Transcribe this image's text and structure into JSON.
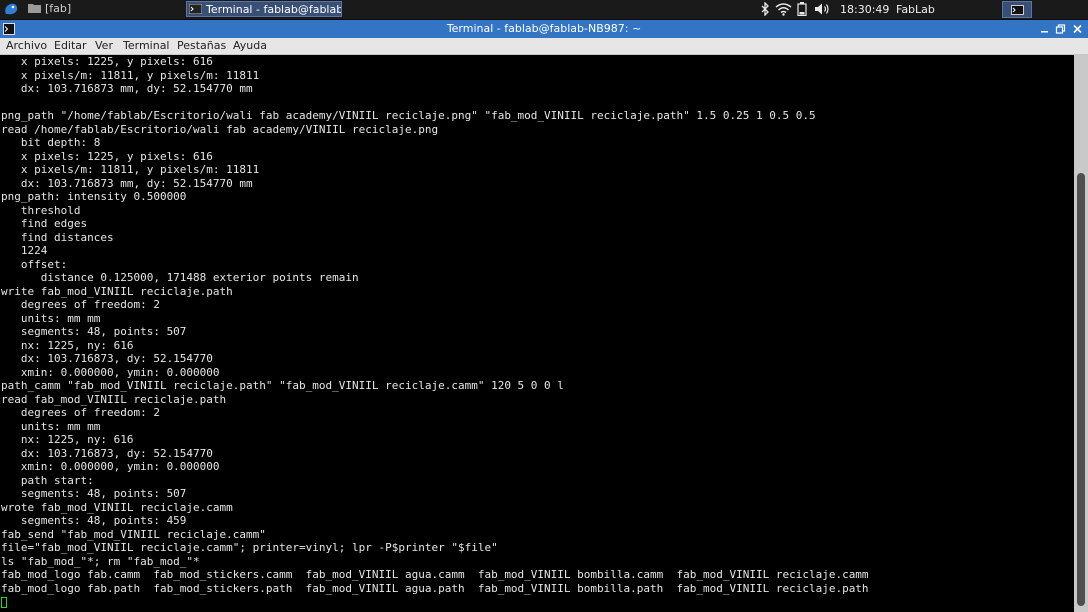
{
  "taskbar": {
    "start_icon": "xfce-mouse-icon",
    "tasks": [
      {
        "label": "[fab]",
        "icon": "folder-icon"
      },
      {
        "label": "Terminal - fablab@fablab-...",
        "icon": "terminal-icon"
      }
    ],
    "tray_icons": [
      "bluetooth-icon",
      "wifi-icon",
      "battery-icon",
      "volume-icon"
    ],
    "clock": "18:30:49",
    "hostname": "FabLab",
    "accent": "#3374c4"
  },
  "window": {
    "title": "Terminal - fablab@fablab-NB987: ~"
  },
  "menu": [
    "Archivo",
    "Editar",
    "Ver",
    "Terminal",
    "Pestañas",
    "Ayuda"
  ],
  "terminal": {
    "prompt_color": "#2fd12f",
    "lines": [
      "   x pixels: 1225, y pixels: 616",
      "   x pixels/m: 11811, y pixels/m: 11811",
      "   dx: 103.716873 mm, dy: 52.154770 mm",
      "",
      "png_path \"/home/fablab/Escritorio/wali fab academy/VINIIL reciclaje.png\" \"fab_mod_VINIIL reciclaje.path\" 1.5 0.25 1 0.5 0.5",
      "read /home/fablab/Escritorio/wali fab academy/VINIIL reciclaje.png",
      "   bit depth: 8",
      "   x pixels: 1225, y pixels: 616",
      "   x pixels/m: 11811, y pixels/m: 11811",
      "   dx: 103.716873 mm, dy: 52.154770 mm",
      "png_path: intensity 0.500000",
      "   threshold",
      "   find edges",
      "   find distances",
      "   1224",
      "   offset:",
      "      distance 0.125000, 171488 exterior points remain",
      "write fab_mod_VINIIL reciclaje.path",
      "   degrees of freedom: 2",
      "   units: mm mm",
      "   segments: 48, points: 507",
      "   nx: 1225, ny: 616",
      "   dx: 103.716873, dy: 52.154770",
      "   xmin: 0.000000, ymin: 0.000000",
      "path_camm \"fab_mod_VINIIL reciclaje.path\" \"fab_mod_VINIIL reciclaje.camm\" 120 5 0 0 l",
      "read fab_mod_VINIIL reciclaje.path",
      "   degrees of freedom: 2",
      "   units: mm mm",
      "   nx: 1225, ny: 616",
      "   dx: 103.716873, dy: 52.154770",
      "   xmin: 0.000000, ymin: 0.000000",
      "   path start:",
      "   segments: 48, points: 507",
      "wrote fab_mod_VINIIL reciclaje.camm",
      "   segments: 48, points: 459",
      "fab_send \"fab_mod_VINIIL reciclaje.camm\"",
      "file=\"fab_mod_VINIIL reciclaje.camm\"; printer=vinyl; lpr -P$printer \"$file\"",
      "ls \"fab_mod_\"*; rm \"fab_mod_\"*",
      "fab_mod_logo fab.camm  fab_mod_stickers.camm  fab_mod_VINIIL agua.camm  fab_mod_VINIIL bombilla.camm  fab_mod_VINIIL reciclaje.camm",
      "fab_mod_logo fab.path  fab_mod_stickers.path  fab_mod_VINIIL agua.path  fab_mod_VINIIL bombilla.path  fab_mod_VINIIL reciclaje.path"
    ]
  }
}
